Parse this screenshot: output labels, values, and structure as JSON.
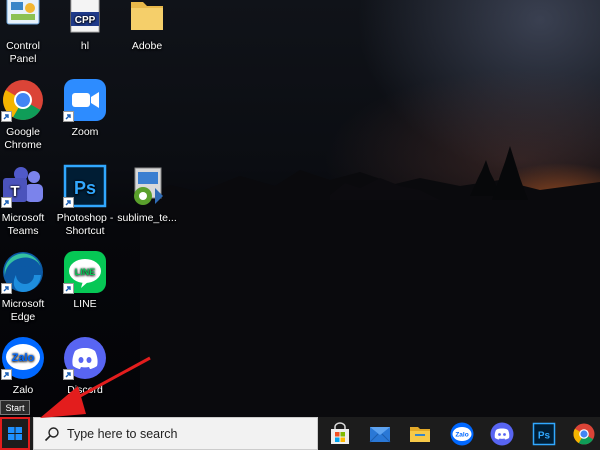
{
  "desktop": {
    "icons": [
      {
        "name": "control-panel",
        "label": "Control Panel",
        "icon": "control-panel-icon",
        "shortcut": false
      },
      {
        "name": "hl",
        "label": "hl",
        "icon": "cpp-file-icon",
        "icon_text": "CPP",
        "shortcut": false
      },
      {
        "name": "adobe",
        "label": "Adobe",
        "icon": "folder-icon",
        "shortcut": false
      },
      {
        "name": "google-chrome",
        "label": "Google Chrome",
        "icon": "chrome-icon",
        "shortcut": true
      },
      {
        "name": "zoom",
        "label": "Zoom",
        "icon": "zoom-icon",
        "shortcut": true
      },
      {
        "name": "microsoft-teams",
        "label": "Microsoft Teams",
        "icon": "teams-icon",
        "icon_text": "T",
        "shortcut": true
      },
      {
        "name": "photoshop-shortcut",
        "label": "Photoshop - Shortcut",
        "icon": "photoshop-icon",
        "icon_text": "Ps",
        "shortcut": true
      },
      {
        "name": "sublime-text",
        "label": "sublime_te...",
        "icon": "installer-icon",
        "shortcut": false
      },
      {
        "name": "microsoft-edge",
        "label": "Microsoft Edge",
        "icon": "edge-icon",
        "shortcut": true
      },
      {
        "name": "line",
        "label": "LINE",
        "icon": "line-icon",
        "icon_text": "LINE",
        "shortcut": true
      },
      {
        "name": "zalo",
        "label": "Zalo",
        "icon": "zalo-icon",
        "icon_text": "Zalo",
        "shortcut": true
      },
      {
        "name": "discord",
        "label": "Discord",
        "icon": "discord-icon",
        "shortcut": true
      }
    ]
  },
  "start_tooltip": "Start",
  "taskbar": {
    "search_placeholder": "Type here to search",
    "apps": [
      {
        "name": "microsoft-store",
        "icon": "store-icon"
      },
      {
        "name": "mail",
        "icon": "mail-icon"
      },
      {
        "name": "file-explorer",
        "icon": "folder-icon"
      },
      {
        "name": "zalo",
        "icon": "zalo-icon",
        "icon_text": "Zalo"
      },
      {
        "name": "discord",
        "icon": "discord-icon"
      },
      {
        "name": "photoshop",
        "icon": "photoshop-icon",
        "icon_text": "Ps"
      },
      {
        "name": "google-chrome",
        "icon": "chrome-icon"
      }
    ]
  },
  "colors": {
    "taskbar": "#1c1c1c",
    "highlight": "#e31d1d",
    "windows_blue": "#1e90ff"
  }
}
